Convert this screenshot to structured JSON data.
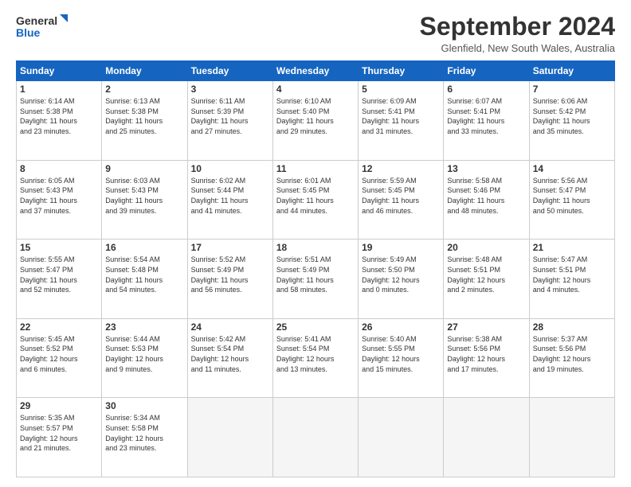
{
  "header": {
    "logo_line1": "General",
    "logo_line2": "Blue",
    "month_title": "September 2024",
    "location": "Glenfield, New South Wales, Australia"
  },
  "weekdays": [
    "Sunday",
    "Monday",
    "Tuesday",
    "Wednesday",
    "Thursday",
    "Friday",
    "Saturday"
  ],
  "weeks": [
    [
      {
        "day": 1,
        "sunrise": "6:14 AM",
        "sunset": "5:38 PM",
        "daylight": "11 hours and 23 minutes."
      },
      {
        "day": 2,
        "sunrise": "6:13 AM",
        "sunset": "5:38 PM",
        "daylight": "11 hours and 25 minutes."
      },
      {
        "day": 3,
        "sunrise": "6:11 AM",
        "sunset": "5:39 PM",
        "daylight": "11 hours and 27 minutes."
      },
      {
        "day": 4,
        "sunrise": "6:10 AM",
        "sunset": "5:40 PM",
        "daylight": "11 hours and 29 minutes."
      },
      {
        "day": 5,
        "sunrise": "6:09 AM",
        "sunset": "5:41 PM",
        "daylight": "11 hours and 31 minutes."
      },
      {
        "day": 6,
        "sunrise": "6:07 AM",
        "sunset": "5:41 PM",
        "daylight": "11 hours and 33 minutes."
      },
      {
        "day": 7,
        "sunrise": "6:06 AM",
        "sunset": "5:42 PM",
        "daylight": "11 hours and 35 minutes."
      }
    ],
    [
      {
        "day": 8,
        "sunrise": "6:05 AM",
        "sunset": "5:43 PM",
        "daylight": "11 hours and 37 minutes."
      },
      {
        "day": 9,
        "sunrise": "6:03 AM",
        "sunset": "5:43 PM",
        "daylight": "11 hours and 39 minutes."
      },
      {
        "day": 10,
        "sunrise": "6:02 AM",
        "sunset": "5:44 PM",
        "daylight": "11 hours and 41 minutes."
      },
      {
        "day": 11,
        "sunrise": "6:01 AM",
        "sunset": "5:45 PM",
        "daylight": "11 hours and 44 minutes."
      },
      {
        "day": 12,
        "sunrise": "5:59 AM",
        "sunset": "5:45 PM",
        "daylight": "11 hours and 46 minutes."
      },
      {
        "day": 13,
        "sunrise": "5:58 AM",
        "sunset": "5:46 PM",
        "daylight": "11 hours and 48 minutes."
      },
      {
        "day": 14,
        "sunrise": "5:56 AM",
        "sunset": "5:47 PM",
        "daylight": "11 hours and 50 minutes."
      }
    ],
    [
      {
        "day": 15,
        "sunrise": "5:55 AM",
        "sunset": "5:47 PM",
        "daylight": "11 hours and 52 minutes."
      },
      {
        "day": 16,
        "sunrise": "5:54 AM",
        "sunset": "5:48 PM",
        "daylight": "11 hours and 54 minutes."
      },
      {
        "day": 17,
        "sunrise": "5:52 AM",
        "sunset": "5:49 PM",
        "daylight": "11 hours and 56 minutes."
      },
      {
        "day": 18,
        "sunrise": "5:51 AM",
        "sunset": "5:49 PM",
        "daylight": "11 hours and 58 minutes."
      },
      {
        "day": 19,
        "sunrise": "5:49 AM",
        "sunset": "5:50 PM",
        "daylight": "12 hours and 0 minutes."
      },
      {
        "day": 20,
        "sunrise": "5:48 AM",
        "sunset": "5:51 PM",
        "daylight": "12 hours and 2 minutes."
      },
      {
        "day": 21,
        "sunrise": "5:47 AM",
        "sunset": "5:51 PM",
        "daylight": "12 hours and 4 minutes."
      }
    ],
    [
      {
        "day": 22,
        "sunrise": "5:45 AM",
        "sunset": "5:52 PM",
        "daylight": "12 hours and 6 minutes."
      },
      {
        "day": 23,
        "sunrise": "5:44 AM",
        "sunset": "5:53 PM",
        "daylight": "12 hours and 9 minutes."
      },
      {
        "day": 24,
        "sunrise": "5:42 AM",
        "sunset": "5:54 PM",
        "daylight": "12 hours and 11 minutes."
      },
      {
        "day": 25,
        "sunrise": "5:41 AM",
        "sunset": "5:54 PM",
        "daylight": "12 hours and 13 minutes."
      },
      {
        "day": 26,
        "sunrise": "5:40 AM",
        "sunset": "5:55 PM",
        "daylight": "12 hours and 15 minutes."
      },
      {
        "day": 27,
        "sunrise": "5:38 AM",
        "sunset": "5:56 PM",
        "daylight": "12 hours and 17 minutes."
      },
      {
        "day": 28,
        "sunrise": "5:37 AM",
        "sunset": "5:56 PM",
        "daylight": "12 hours and 19 minutes."
      }
    ],
    [
      {
        "day": 29,
        "sunrise": "5:35 AM",
        "sunset": "5:57 PM",
        "daylight": "12 hours and 21 minutes."
      },
      {
        "day": 30,
        "sunrise": "5:34 AM",
        "sunset": "5:58 PM",
        "daylight": "12 hours and 23 minutes."
      },
      null,
      null,
      null,
      null,
      null
    ]
  ]
}
